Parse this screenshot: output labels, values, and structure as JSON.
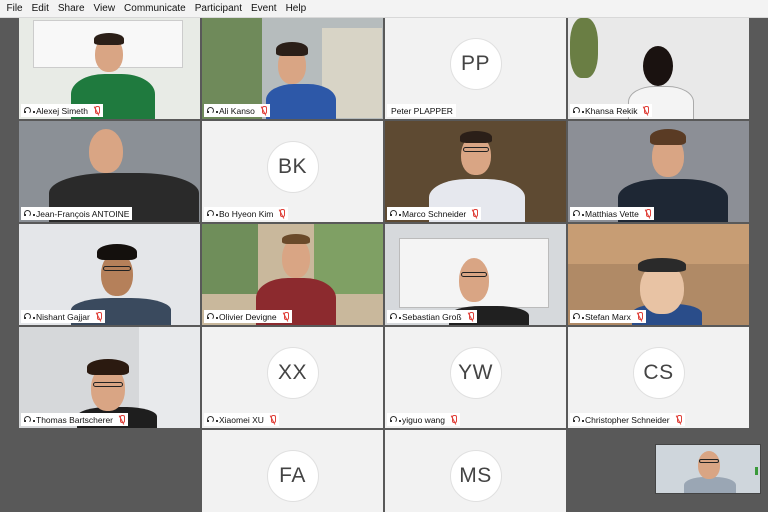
{
  "menu": [
    "File",
    "Edit",
    "Share",
    "View",
    "Communicate",
    "Participant",
    "Event",
    "Help"
  ],
  "participants": [
    {
      "name": "Alexej Simeth",
      "initials": ""
    },
    {
      "name": "Ali Kanso",
      "initials": ""
    },
    {
      "name": "Peter PLAPPER",
      "initials": "PP"
    },
    {
      "name": "Khansa Rekik",
      "initials": ""
    },
    {
      "name": "Jean-François ANTOINE",
      "initials": ""
    },
    {
      "name": "Bo Hyeon Kim",
      "initials": "BK"
    },
    {
      "name": "Marco Schneider",
      "initials": ""
    },
    {
      "name": "Matthias Vette",
      "initials": ""
    },
    {
      "name": "Nishant Gajjar",
      "initials": ""
    },
    {
      "name": "Olivier Devigne",
      "initials": ""
    },
    {
      "name": "Sebastian Groß",
      "initials": ""
    },
    {
      "name": "Stefan Marx",
      "initials": ""
    },
    {
      "name": "Thomas Bartscherer",
      "initials": ""
    },
    {
      "name": "Xiaomei XU",
      "initials": "XX"
    },
    {
      "name": "yiguo wang",
      "initials": "YW"
    },
    {
      "name": "Christopher Schneider",
      "initials": "CS"
    },
    {
      "name": "",
      "initials": "FA"
    },
    {
      "name": "",
      "initials": "MS"
    }
  ],
  "icons": {
    "audio": "headset-icon",
    "muted": "muted-mic-icon",
    "warning": "warning-icon"
  },
  "colors": {
    "muted": "#e0413a",
    "warning": "#f0a020",
    "tile_background": "#f2f2f2",
    "stage_background": "#595959"
  }
}
